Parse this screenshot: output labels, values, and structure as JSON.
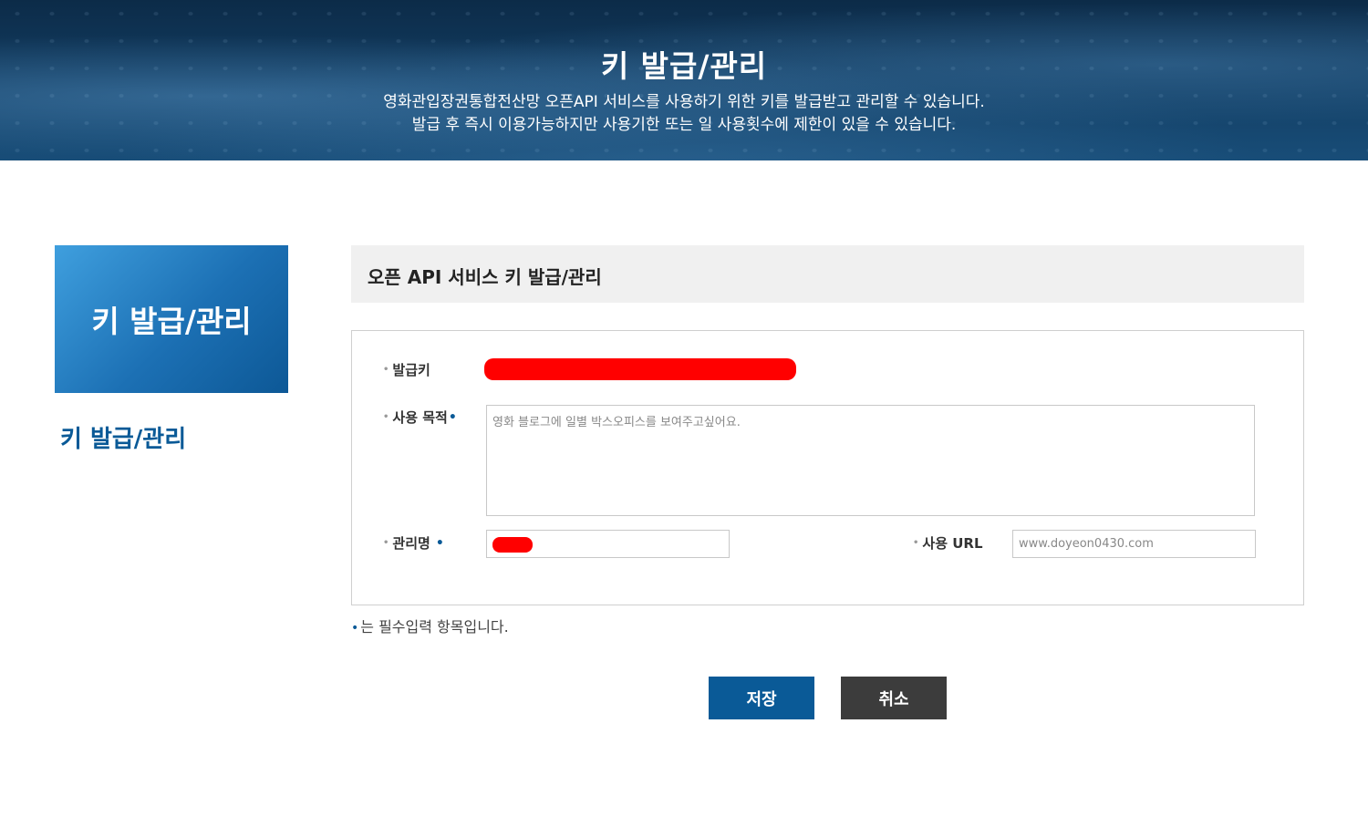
{
  "hero": {
    "title": "키 발급/관리",
    "desc_line1": "영화관입장권통합전산망 오픈API 서비스를 사용하기 위한 키를 발급받고 관리할 수 있습니다.",
    "desc_line2": "발급 후 즉시 이용가능하지만 사용기한 또는 일 사용횟수에 제한이 있을 수 있습니다."
  },
  "sidebar": {
    "box_title": "키 발급/관리",
    "link_label": "키 발급/관리"
  },
  "section": {
    "title": "오픈 API 서비스 키 발급/관리"
  },
  "form": {
    "key_label": "발급키",
    "purpose_label": "사용 목적",
    "purpose_value": "영화 블로그에 일별 박스오피스를 보여주고싶어요.",
    "name_label": "관리명",
    "url_label": "사용 URL",
    "url_value": "www.doyeon0430.com",
    "required_marker": "•",
    "bullet": "•"
  },
  "note": {
    "text": "는 필수입력 항목입니다."
  },
  "buttons": {
    "save_label": "저장",
    "cancel_label": "취소"
  },
  "colors": {
    "accent": "#0a5a97",
    "cancel": "#3c3c3c",
    "redaction": "#ff0000"
  }
}
